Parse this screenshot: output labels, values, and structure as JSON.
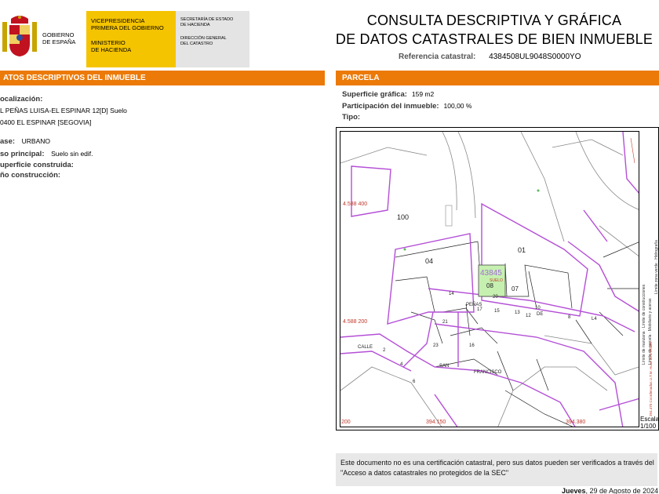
{
  "header": {
    "gov_country": [
      "GOBIERNO",
      "DE ESPAÑA"
    ],
    "ministry_top": [
      "VICEPRESIDENCIA",
      "PRIMERA DEL GOBIERNO"
    ],
    "ministry_bottom": [
      "MINISTERIO",
      "DE HACIENDA"
    ],
    "secretaria": [
      "SECRETARÍA DE ESTADO",
      "DE HACIENDA"
    ],
    "direccion": [
      "DIRECCIÓN GENERAL",
      "DEL CATASTRO"
    ],
    "title_line1": "CONSULTA DESCRIPTIVA Y GRÁFICA",
    "title_line2": "DE DATOS CATASTRALES DE BIEN INMUEBLE",
    "ref_label": "Referencia catastral:",
    "ref_value": "4384508UL9048S0000YO",
    "colors": {
      "orange": "#ec7a08",
      "yellow": "#f5c400",
      "parcel_purple": "#b44fd6",
      "highlight_green": "#c6f0b0"
    }
  },
  "left": {
    "bar": "ATOS DESCRIPTIVOS DEL INMUEBLE",
    "localizacion_label": "ocalización:",
    "addr1": "L PEÑAS LUISA-EL ESPINAR 12[D] Suelo",
    "addr2": "0400 EL ESPINAR [SEGOVIA]",
    "clase_label": "ase:",
    "clase_value": "URBANO",
    "uso_label": "so principal:",
    "uso_value": "Suelo sin edif.",
    "superficie_label": "uperficie construida:",
    "anio_label": "ño construcción:"
  },
  "right": {
    "bar": "PARCELA",
    "superficie_label": "Superficie gráfica:",
    "superficie_value": "159 m2",
    "participacion_label": "Participación del inmueble:",
    "participacion_value": "100,00 %",
    "tipo_label": "Tipo:"
  },
  "map": {
    "labels": {
      "p100": "100",
      "p01": "01",
      "p04": "04",
      "p08": "08",
      "p07": "07",
      "p43845": "43845",
      "suelo": "SUELO",
      "p20": "20",
      "peñas": "PEÑAS",
      "de": "DE",
      "calle": "CALLE",
      "san": "SAN",
      "francisco": "FRANCISCO",
      "n14": "14",
      "n15": "15",
      "n13": "13",
      "n12": "12",
      "n10": "10",
      "n8": "8",
      "n17": "17",
      "n21": "21",
      "n23": "23",
      "n2": "2",
      "n4": "4",
      "n6": "6",
      "l4": "L4",
      "n16": "16"
    },
    "coords": {
      "c1": "4.588 400",
      "c2": "4.588 200",
      "c3": "394.150",
      "c4": "394.380",
      "c5": "200"
    },
    "legend": [
      "Límite de manzana",
      "Límite de parcela",
      "Límite de construcciones",
      "Mobiliario y aceras",
      "Límite zona verde",
      "Hidrografía"
    ],
    "side_note": "394.470 Coordenadas U.T.M. Huso 30 ETRS89",
    "escala_label": "Escala:",
    "escala_value": "1/100"
  },
  "notice": {
    "text": "Este documento no es una certificación catastral, pero sus datos pueden ser verificados a través del \"Acceso a datos catastrales no protegidos de la SEC\""
  },
  "date": {
    "day": "Jueves",
    "rest": ", 29 de Agosto de 2024"
  }
}
